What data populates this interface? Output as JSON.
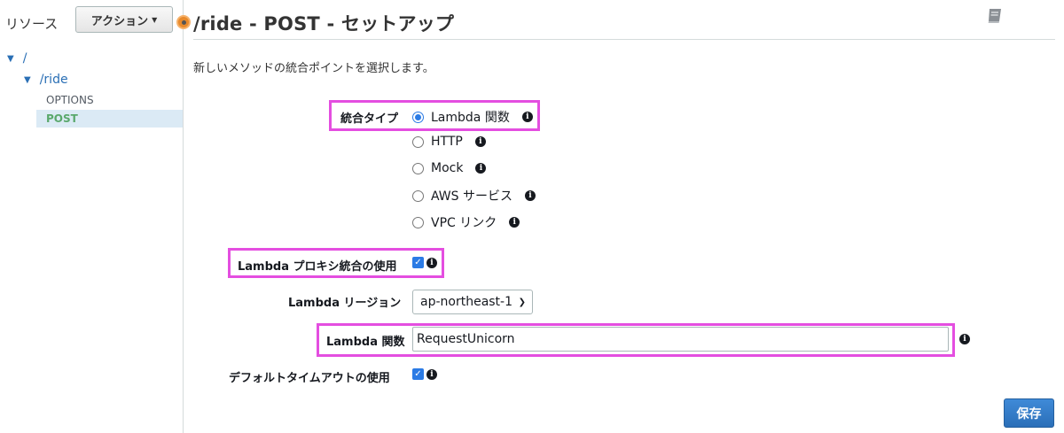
{
  "sidebar": {
    "resources_label": "リソース",
    "actions_label": "アクション",
    "tree": {
      "root": "/",
      "child": "/ride",
      "methods": [
        "OPTIONS",
        "POST"
      ]
    }
  },
  "header": {
    "title": "/ride - POST - セットアップ"
  },
  "description": "新しいメソッドの統合ポイントを選択します。",
  "form": {
    "integration_type_label": "統合タイプ",
    "integration_options": [
      {
        "label": "Lambda 関数",
        "selected": true
      },
      {
        "label": "HTTP",
        "selected": false
      },
      {
        "label": "Mock",
        "selected": false
      },
      {
        "label": "AWS サービス",
        "selected": false
      },
      {
        "label": "VPC リンク",
        "selected": false
      }
    ],
    "proxy_label": "Lambda プロキシ統合の使用",
    "proxy_checked": true,
    "region_label": "Lambda リージョン",
    "region_value": "ap-northeast-1",
    "function_label": "Lambda 関数",
    "function_value": "RequestUnicorn",
    "timeout_label": "デフォルトタイムアウトの使用",
    "timeout_checked": true
  },
  "save_label": "保存",
  "colors": {
    "highlight": "#e44ee0",
    "primary": "#2b7be5",
    "link": "#2a6fb5",
    "post_method": "#5aa86c"
  }
}
